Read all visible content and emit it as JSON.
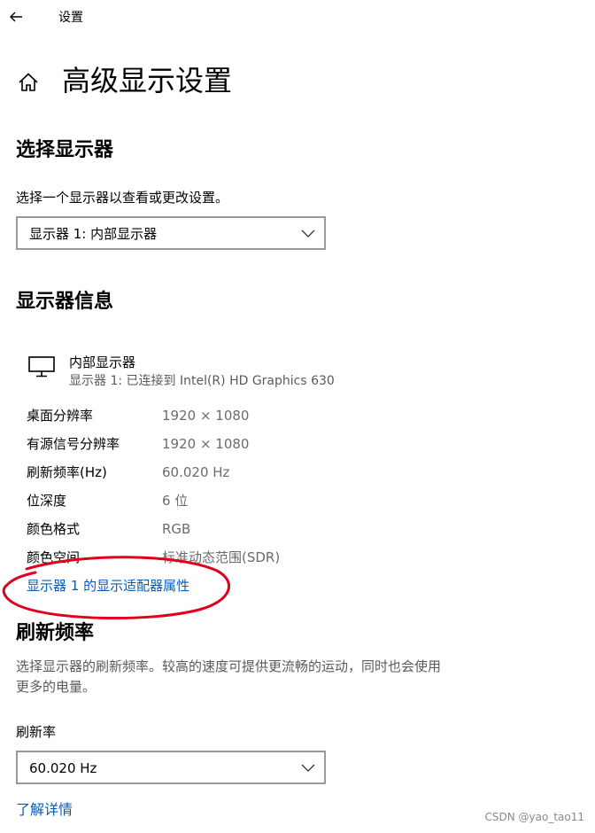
{
  "titlebar": {
    "title": "设置"
  },
  "header": {
    "page_title": "高级显示设置"
  },
  "select_display": {
    "title": "选择显示器",
    "description": "选择一个显示器以查看或更改设置。",
    "dropdown_value": "显示器 1: 内部显示器"
  },
  "display_info": {
    "title": "显示器信息",
    "display_name": "内部显示器",
    "display_subtitle": "显示器 1: 已连接到 Intel(R) HD Graphics 630",
    "rows": [
      {
        "label": "桌面分辨率",
        "value": "1920 × 1080"
      },
      {
        "label": "有源信号分辨率",
        "value": "1920 × 1080"
      },
      {
        "label": "刷新频率(Hz)",
        "value": "60.020 Hz"
      },
      {
        "label": "位深度",
        "value": "6 位"
      },
      {
        "label": "颜色格式",
        "value": "RGB"
      },
      {
        "label": "颜色空间",
        "value": "标准动态范围(SDR)"
      }
    ],
    "adapter_link": "显示器 1 的显示适配器属性"
  },
  "refresh_rate": {
    "title": "刷新频率",
    "description_line1": "选择显示器的刷新频率。较高的速度可提供更流畅的运动，同时也会使用",
    "description_line2": "更多的电量。",
    "label": "刷新率",
    "dropdown_value": "60.020 Hz",
    "learn_more": "了解详情"
  },
  "watermark": "CSDN @yao_tao11",
  "colors": {
    "link": "#0a5cb0",
    "annotation": "#e0001b",
    "select_border": "#999999"
  },
  "icons": [
    "back-arrow-icon",
    "home-icon",
    "chevron-down-icon",
    "monitor-icon"
  ]
}
